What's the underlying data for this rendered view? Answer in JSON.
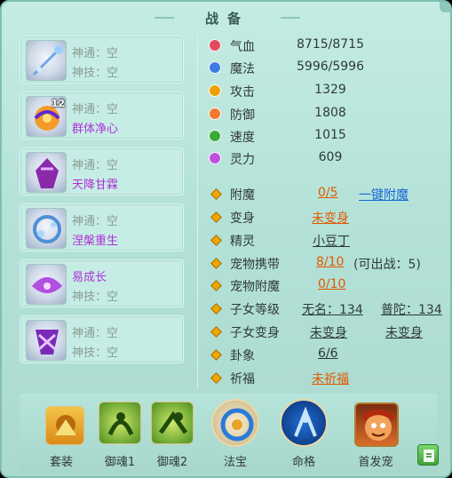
{
  "window": {
    "title": "战备"
  },
  "slots": [
    {
      "icon": "staff-weapon-icon",
      "line1": "神通：空",
      "line2": "神技：空",
      "line2_color": "gray",
      "level": ""
    },
    {
      "icon": "bird-spirit-icon",
      "line1": "神通：空",
      "line2": "群体净心",
      "line2_color": "purple",
      "level": "12"
    },
    {
      "icon": "purple-demon-icon",
      "line1": "神通：空",
      "line2": "天降甘霖",
      "line2_color": "purple",
      "level": ""
    },
    {
      "icon": "blue-bubble-icon",
      "line1": "神通：空",
      "line2": "涅槃重生",
      "line2_color": "purple",
      "level": ""
    },
    {
      "icon": "purple-wing-icon",
      "line1": "易成长",
      "line1_color": "purple",
      "line2": "神技：空",
      "line2_color": "gray",
      "level": ""
    },
    {
      "icon": "purple-mask-icon",
      "line1": "神通：空",
      "line2": "神技：空",
      "line2_color": "gray",
      "level": ""
    }
  ],
  "stats": [
    {
      "icon": "heart-icon",
      "color": "#e34b5d",
      "label": "气血",
      "value": "8715/8715"
    },
    {
      "icon": "mana-icon",
      "color": "#3d7ce0",
      "label": "魔法",
      "value": "5996/5996"
    },
    {
      "icon": "attack-icon",
      "color": "#f0a000",
      "label": "攻击",
      "value": "1329"
    },
    {
      "icon": "defense-icon",
      "color": "#f07a2e",
      "label": "防御",
      "value": "1808"
    },
    {
      "icon": "speed-icon",
      "color": "#3aa93a",
      "label": "速度",
      "value": "1015"
    },
    {
      "icon": "spirit-icon",
      "color": "#c04fe0",
      "label": "灵力",
      "value": "609"
    }
  ],
  "rows": [
    {
      "label": "附魔",
      "v1": "0/5",
      "v1_style": "orange underline",
      "v2": "一键附魔",
      "v2_style": "blue underline"
    },
    {
      "label": "变身",
      "v1": "未变身",
      "v1_style": "orange underline"
    },
    {
      "label": "精灵",
      "v1": "小豆丁",
      "v1_style": "dark underline"
    },
    {
      "label": "宠物携带",
      "v1": "8/10",
      "v1_style": "orange underline",
      "v2": "(可出战：5)",
      "v2_style": "dark"
    },
    {
      "label": "宠物附魔",
      "v1": "0/10",
      "v1_style": "orange underline"
    },
    {
      "label": "子女等级",
      "v1": "无名：134",
      "v1_style": "dark underline",
      "v2": "普陀：134",
      "v2_style": "dark underline"
    },
    {
      "label": "子女变身",
      "v1": "未变身",
      "v1_style": "dark underline",
      "v2": "未变身",
      "v2_style": "dark underline"
    },
    {
      "label": "卦象",
      "v1": "6/6",
      "v1_style": "dark underline"
    },
    {
      "label": "祈福",
      "v1": "未祈福",
      "v1_style": "orange underline"
    }
  ],
  "bottom": {
    "buttons": [
      {
        "icon": "armor-set-icon",
        "label": "套装"
      },
      {
        "icon": "soul1-icon",
        "label": "御魂1"
      },
      {
        "icon": "soul2-icon",
        "label": "御魂2"
      },
      {
        "icon": "magic-treasure-icon",
        "label": "法宝"
      },
      {
        "icon": "destiny-icon",
        "label": "命格"
      },
      {
        "icon": "first-pet-icon",
        "label": "首发宠"
      }
    ],
    "edit_icon": "edit-icon"
  }
}
